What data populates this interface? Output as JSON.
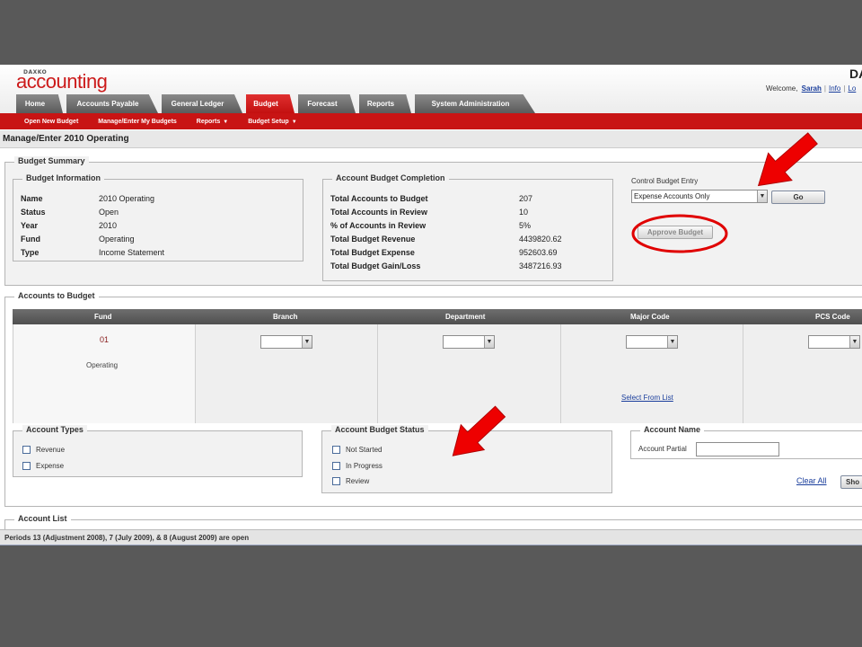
{
  "app": {
    "logo_small": "DAXKO",
    "logo": "accounting",
    "corner_text": "DA",
    "welcome_prefix": "Welcome,",
    "user_name": "Sarah",
    "info_link": "Info",
    "logout_link": "Lo"
  },
  "tabs": [
    {
      "label": "Home",
      "active": false
    },
    {
      "label": "Accounts Payable",
      "active": false
    },
    {
      "label": "General Ledger",
      "active": false
    },
    {
      "label": "Budget",
      "active": true
    },
    {
      "label": "Forecast",
      "active": false
    },
    {
      "label": "Reports",
      "active": false
    },
    {
      "label": "System Administration",
      "active": false
    }
  ],
  "subnav": {
    "open_new_budget": "Open New Budget",
    "manage_enter": "Manage/Enter My Budgets",
    "reports": "Reports",
    "budget_setup": "Budget Setup",
    "caret": "▼"
  },
  "page_title": "Manage/Enter 2010 Operating",
  "budget_summary": {
    "legend": "Budget Summary",
    "info_legend": "Budget Information",
    "info": [
      {
        "key": "Name",
        "value": "2010 Operating"
      },
      {
        "key": "Status",
        "value": "Open"
      },
      {
        "key": "Year",
        "value": "2010"
      },
      {
        "key": "Fund",
        "value": "Operating"
      },
      {
        "key": "Type",
        "value": "Income Statement"
      }
    ],
    "completion_legend": "Account Budget Completion",
    "completion": [
      {
        "key": "Total Accounts to Budget",
        "value": "207"
      },
      {
        "key": "Total Accounts in Review",
        "value": "10"
      },
      {
        "key": "% of Accounts in Review",
        "value": "5%"
      },
      {
        "key": "Total Budget Revenue",
        "value": "4439820.62"
      },
      {
        "key": "Total Budget Expense",
        "value": "952603.69"
      },
      {
        "key": "Total Budget Gain/Loss",
        "value": "3487216.93"
      }
    ],
    "control_label": "Control Budget Entry",
    "control_value": "Expense Accounts Only",
    "go_label": "Go",
    "approve_label": "Approve Budget"
  },
  "accounts_to_budget": {
    "legend": "Accounts to Budget",
    "columns": [
      "Fund",
      "Branch",
      "Department",
      "Major Code",
      "PCS Code"
    ],
    "fund_code": "01",
    "fund_name": "Operating",
    "select_from_list": "Select From List",
    "account_types_legend": "Account Types",
    "account_types": [
      "Revenue",
      "Expense"
    ],
    "status_legend": "Account Budget Status",
    "statuses": [
      "Not Started",
      "In Progress",
      "Review"
    ],
    "account_name_legend": "Account Name",
    "account_partial_label": "Account Partial",
    "clear_all": "Clear All",
    "show_label": "Sho"
  },
  "account_list": {
    "legend": "Account List"
  },
  "footer": "Periods 13 (Adjustment 2008), 7 (July 2009), & 8 (August 2009) are open",
  "colors": {
    "brand_red": "#c81414",
    "annotation_red": "#e00000"
  }
}
